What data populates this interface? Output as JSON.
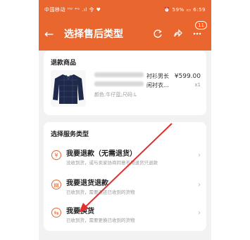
{
  "statusbar": {
    "left": "中国移动 ᴴᴰ ⁴ᴳ .ıl 令 ♥",
    "right": "⏰ 59% ▭ 6:59"
  },
  "nav": {
    "title": "选择售后类型",
    "badge": "11"
  },
  "product_card": {
    "title": "退款商品",
    "name_line1": "衬衫男长",
    "name_line2": "闲衬衣...",
    "price": "¥599.00",
    "quantity": "x1",
    "spec": "颜色:牛仔蓝;尺码:L"
  },
  "service_card": {
    "title": "选择服务类型",
    "items": [
      {
        "label": "我要退款（无需退货）",
        "desc": "没收到货，或与卖家协商同意不用退货只退款",
        "icon": "¥"
      },
      {
        "label": "我要退货退款",
        "desc": "已收到货，需要退还已收到的货物",
        "icon": "▤"
      },
      {
        "label": "我要换货",
        "desc": "已收到货，需要更换已收到的货物",
        "icon": "⇆"
      }
    ]
  },
  "colors": {
    "accent": "#e9672f",
    "arrow": "#e03030"
  }
}
